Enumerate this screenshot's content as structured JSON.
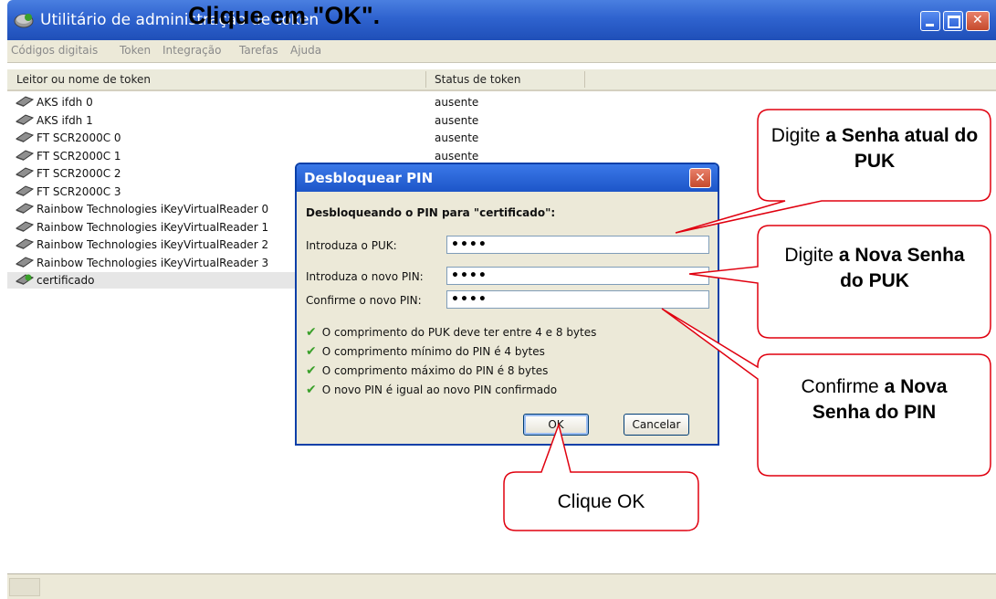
{
  "window": {
    "title": "Utilitário de administração de token",
    "overlay_title": "Clique em \"OK\"."
  },
  "menu": [
    "Códigos digitais",
    "Token",
    "Integração",
    "Tarefas",
    "Ajuda"
  ],
  "columns": {
    "name": "Leitor ou nome de token",
    "status": "Status de token"
  },
  "readers": [
    {
      "name": "AKS ifdh 0",
      "status": "ausente"
    },
    {
      "name": "AKS ifdh 1",
      "status": "ausente"
    },
    {
      "name": "FT SCR2000C 0",
      "status": "ausente"
    },
    {
      "name": "FT SCR2000C 1",
      "status": "ausente"
    },
    {
      "name": "FT SCR2000C 2",
      "status": ""
    },
    {
      "name": "FT SCR2000C 3",
      "status": ""
    },
    {
      "name": "Rainbow Technologies iKeyVirtualReader 0",
      "status": ""
    },
    {
      "name": "Rainbow Technologies iKeyVirtualReader 1",
      "status": ""
    },
    {
      "name": "Rainbow Technologies iKeyVirtualReader 2",
      "status": ""
    },
    {
      "name": "Rainbow Technologies iKeyVirtualReader 3",
      "status": ""
    },
    {
      "name": "certificado",
      "status": ""
    }
  ],
  "dialog": {
    "title": "Desbloquear PIN",
    "heading": "Desbloqueando o PIN para \"certificado\":",
    "puk_label": "Introduza o PUK:",
    "puk_value": "••••",
    "new_pin_label": "Introduza o novo PIN:",
    "new_pin_value": "••••",
    "confirm_label": "Confirme o novo PIN:",
    "confirm_value": "••••",
    "checks": [
      "O comprimento do PUK deve ter entre 4 e 8 bytes",
      "O comprimento mínimo do PIN é 4 bytes",
      "O comprimento máximo do PIN é 8 bytes",
      "O novo PIN é igual ao novo PIN confirmado"
    ],
    "ok_label": "OK",
    "cancel_label": "Cancelar"
  },
  "callouts": {
    "puk": {
      "normal": "Digite ",
      "bold": "a Senha atual do PUK"
    },
    "new": {
      "normal": "Digite ",
      "bold": "a Nova Senha do PUK"
    },
    "confirm": {
      "normal": "Confirme ",
      "bold": "a Nova  Senha do PIN"
    },
    "ok": {
      "normal": "Clique OK"
    }
  },
  "colors": {
    "callout_border": "#e0000f",
    "titlebar": "#2f63cf",
    "check": "#3aa02a"
  },
  "icons": {
    "reader": "card-reader-icon",
    "token": "token-icon",
    "app": "token-utility-icon"
  }
}
